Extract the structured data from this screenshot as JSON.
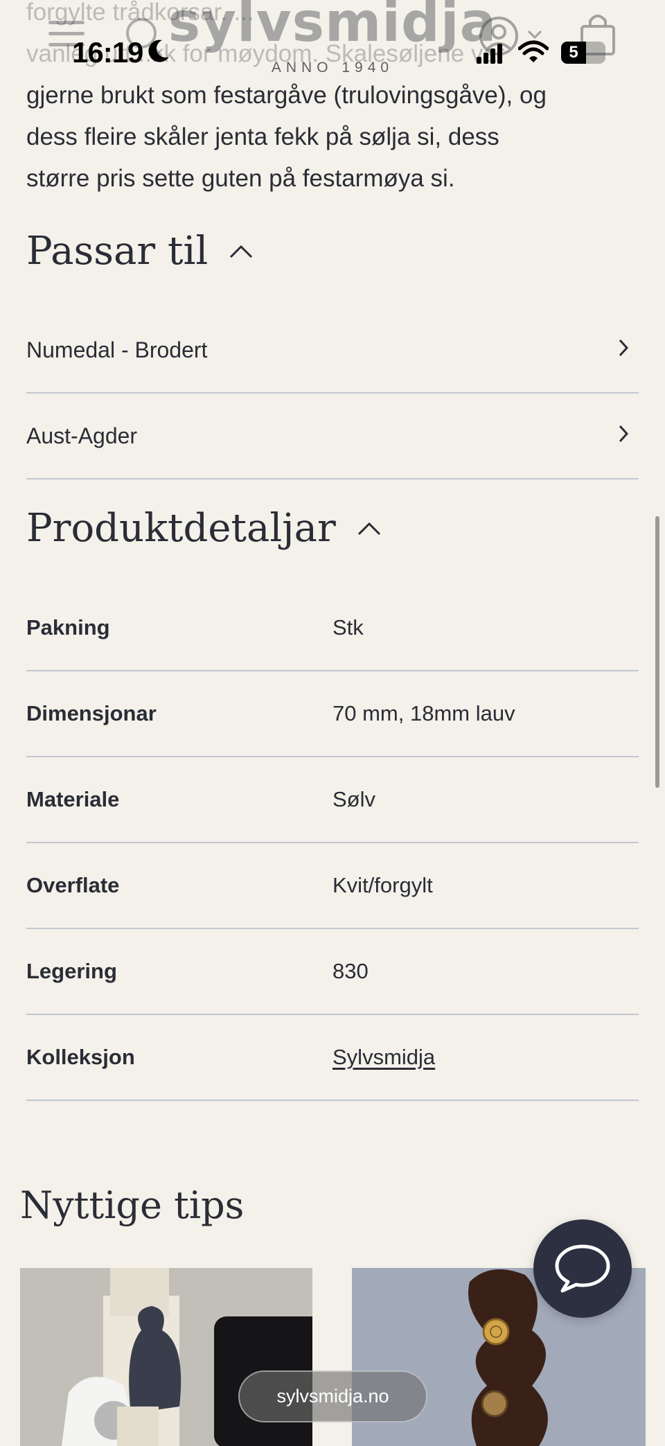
{
  "status_bar": {
    "time": "16:19",
    "battery": "5"
  },
  "header": {
    "logo": "sylvsmidja",
    "tagline": "ANNO 1940"
  },
  "intro": {
    "faded_line1": "forgylte trådkorsar. ...",
    "faded_line2": "vanleg utt...kk for møydom. Skalesøljene var",
    "line3": "gjerne brukt som festargåve (trulovingsgåve), og",
    "line4": "dess fleire skåler jenta fekk på sølja si, dess",
    "line5": "større pris sette guten på festarmøya si."
  },
  "passar_til": {
    "title": "Passar til",
    "items": [
      {
        "label": "Numedal - Brodert"
      },
      {
        "label": "Aust-Agder"
      }
    ]
  },
  "produktdetaljar": {
    "title": "Produktdetaljar",
    "rows": [
      {
        "key": "Pakning",
        "value": "Stk"
      },
      {
        "key": "Dimensjonar",
        "value": "70 mm, 18mm lauv"
      },
      {
        "key": "Materiale",
        "value": "Sølv"
      },
      {
        "key": "Overflate",
        "value": "Kvit/forgylt"
      },
      {
        "key": "Legering",
        "value": "830"
      },
      {
        "key": "Kolleksjon",
        "value": "Sylvsmidja"
      }
    ]
  },
  "tips": {
    "title": "Nyttige tips"
  },
  "browser": {
    "url": "sylvsmidja.no"
  },
  "colors": {
    "background": "#f3f1e9",
    "text": "#2a2c36",
    "divider": "#c2c6d1",
    "chat_button": "#2c3040"
  },
  "icons": [
    "menu-icon",
    "search-icon",
    "account-icon",
    "chevron-down-icon",
    "cart-icon",
    "chevron-up-icon",
    "chevron-right-icon",
    "chat-icon"
  ]
}
